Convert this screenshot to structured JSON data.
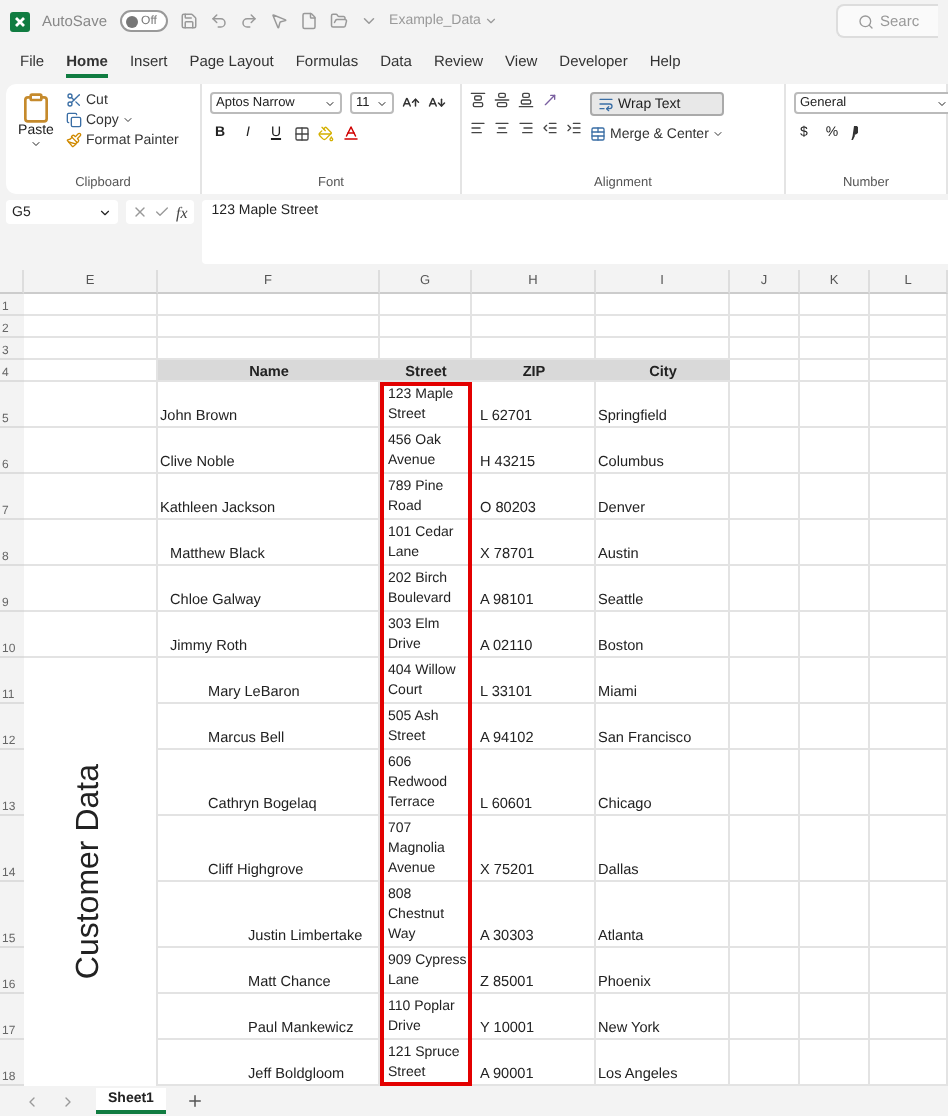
{
  "title_bar": {
    "autosave_label": "AutoSave",
    "autosave_on": false,
    "autosave_state": "Off",
    "file_name": "Example_Data",
    "search_placeholder": "Searc"
  },
  "menu": [
    {
      "label": "File",
      "selected": false
    },
    {
      "label": "Home",
      "selected": true
    },
    {
      "label": "Insert",
      "selected": false
    },
    {
      "label": "Page Layout",
      "selected": false
    },
    {
      "label": "Formulas",
      "selected": false
    },
    {
      "label": "Data",
      "selected": false
    },
    {
      "label": "Review",
      "selected": false
    },
    {
      "label": "View",
      "selected": false
    },
    {
      "label": "Developer",
      "selected": false
    },
    {
      "label": "Help",
      "selected": false
    }
  ],
  "ribbon": {
    "clipboard": {
      "paste": "Paste",
      "cut": "Cut",
      "copy": "Copy",
      "format_painter": "Format Painter",
      "label": "Clipboard"
    },
    "font": {
      "name": "Aptos Narrow",
      "size": "11",
      "bold": "B",
      "italic": "I",
      "underline": "U",
      "label": "Font"
    },
    "alignment": {
      "wrap_text": "Wrap Text",
      "wrap_on": true,
      "merge": "Merge & Center",
      "label": "Alignment"
    },
    "number": {
      "format": "General",
      "currency": "$",
      "percent": "%",
      "label": "Number"
    }
  },
  "formula_bar": {
    "name_box": "G5",
    "fx": "fx",
    "value": "123 Maple Street"
  },
  "sheet": {
    "columns": [
      "E",
      "F",
      "G",
      "H",
      "I",
      "J",
      "K",
      "L"
    ],
    "headers": [
      "Name",
      "Street",
      "ZIP",
      "City"
    ],
    "row_numbers": [
      "1",
      "2",
      "3",
      "4",
      "5",
      "6",
      "7",
      "8",
      "9",
      "10",
      "11",
      "12",
      "13",
      "14",
      "15",
      "16",
      "17",
      "18"
    ],
    "side_label": "Customer Data",
    "street_outline": true,
    "rows": [
      {
        "name": "John Brown",
        "kind": "flush",
        "street": [
          "123 Maple",
          "Street"
        ],
        "zip": "L 62701",
        "city": "Springfield"
      },
      {
        "name": "Clive Noble",
        "kind": "flush",
        "street": [
          "456 Oak",
          "Avenue"
        ],
        "zip": "H 43215",
        "city": "Columbus"
      },
      {
        "name": "Kathleen Jackson",
        "kind": "flush",
        "street": [
          "789 Pine",
          "Road"
        ],
        "zip": "O 80203",
        "city": "Denver"
      },
      {
        "name": "Matthew Black",
        "kind": "shallow",
        "street": [
          "101 Cedar",
          "Lane"
        ],
        "zip": "X 78701",
        "city": "Austin"
      },
      {
        "name": "Chloe Galway",
        "kind": "shallow",
        "street": [
          "202 Birch",
          "Boulevard"
        ],
        "zip": "A 98101",
        "city": "Seattle"
      },
      {
        "name": "Jimmy Roth",
        "kind": "shallow",
        "street": [
          "303 Elm",
          "Drive"
        ],
        "zip": "A 02110",
        "city": "Boston"
      },
      {
        "name": "Mary LeBaron",
        "kind": "middle",
        "street": [
          "404 Willow",
          "Court"
        ],
        "zip": "L 33101",
        "city": "Miami"
      },
      {
        "name": "Marcus Bell",
        "kind": "middle",
        "street": [
          "505 Ash",
          "Street"
        ],
        "zip": "A 94102",
        "city": "San Francisco"
      },
      {
        "name": "Cathryn Bogelaq",
        "kind": "middle",
        "street": [
          "606",
          "Redwood",
          "Terrace"
        ],
        "zip": "L 60601",
        "city": "Chicago"
      },
      {
        "name": "Cliff Highgrove",
        "kind": "middle",
        "street": [
          "707",
          "Magnolia",
          "Avenue"
        ],
        "zip": "X 75201",
        "city": "Dallas"
      },
      {
        "name": "Justin Limbertake",
        "kind": "deep",
        "street": [
          "808",
          "Chestnut",
          "Way"
        ],
        "zip": "A 30303",
        "city": "Atlanta"
      },
      {
        "name": "Matt Chance",
        "kind": "deep",
        "street": [
          "909 Cypress",
          "Lane"
        ],
        "zip": "Z 85001",
        "city": "Phoenix"
      },
      {
        "name": "Paul Mankewicz",
        "kind": "deep",
        "street": [
          "110 Poplar",
          "Drive"
        ],
        "zip": "Y 10001",
        "city": "New York"
      },
      {
        "name": "Jeff Boldgloom",
        "kind": "deep",
        "street": [
          "121 Spruce",
          "Street"
        ],
        "zip": "A 90001",
        "city": "Los Angeles"
      }
    ]
  },
  "sheet_tabs": [
    {
      "label": "Sheet1",
      "selected": true
    }
  ]
}
